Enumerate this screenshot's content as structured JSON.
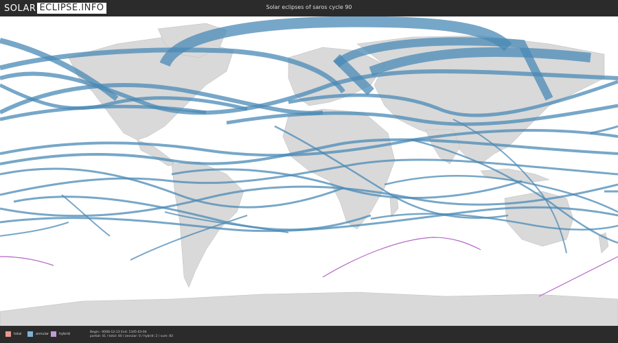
{
  "header": {
    "logo_part1": "SOLAR",
    "logo_part2": "ECLIPSE.INFO",
    "title": "Solar eclipses of saros cycle 90"
  },
  "legend": [
    {
      "label": "total",
      "color": "#e8998d"
    },
    {
      "label": "annular",
      "color": "#7fb3d5"
    },
    {
      "label": "hybrid",
      "color": "#c39bd3"
    }
  ],
  "stats": {
    "range": "Begin: -0008-12-13 End: 1345-03-04",
    "counts": "partial: 41 / total: 40 / annular: 0 / hybrid: 2 / sum: 83"
  },
  "colors": {
    "header_bg": "#2b2b2b",
    "land": "#d9d9d9",
    "ocean": "#ffffff",
    "path": "#4a8ab5",
    "hybrid_path": "#b467c4"
  }
}
